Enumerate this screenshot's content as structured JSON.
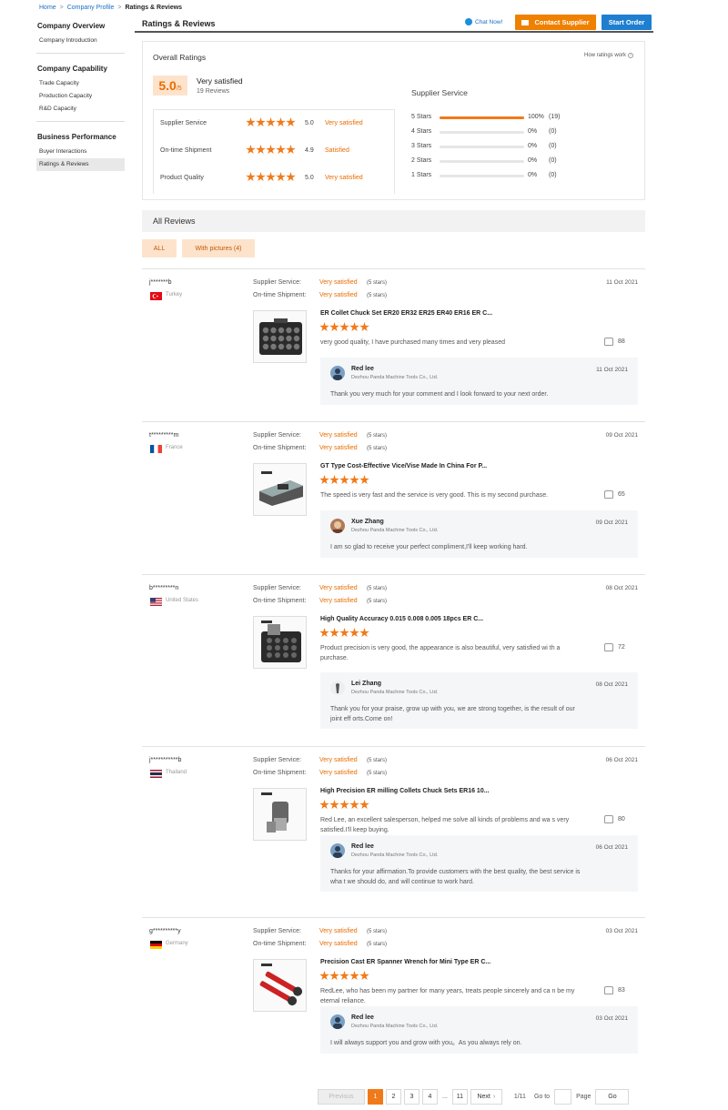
{
  "breadcrumb": {
    "home": "Home",
    "profile": "Company Profile",
    "current": "Ratings & Reviews",
    "sep": ">"
  },
  "sidebar": {
    "sections": [
      {
        "title": "Company Overview",
        "items": [
          "Company Introduction"
        ]
      },
      {
        "title": "Company Capability",
        "items": [
          "Trade Capacity",
          "Production Capacity",
          "R&D Capacity"
        ]
      },
      {
        "title": "Business Performance",
        "items": [
          "Buyer Interactions",
          "Ratings & Reviews"
        ]
      }
    ]
  },
  "header": {
    "title": "Ratings & Reviews",
    "chat": "Chat Now!",
    "contact": "Contact Supplier",
    "order": "Start Order"
  },
  "overall": {
    "title": "Overall Ratings",
    "how": "How ratings work",
    "score": "5.0",
    "scale": "/5",
    "label": "Very satisfied",
    "count": "19 Reviews",
    "rows": [
      {
        "label": "Supplier Service",
        "score": "5.0",
        "text": "Very satisfied",
        "stars": 5
      },
      {
        "label": "On-time Shipment",
        "score": "4.9",
        "text": "Satisfied",
        "stars": 5
      },
      {
        "label": "Product Quality",
        "score": "5.0",
        "text": "Very satisfied",
        "stars": 5
      }
    ],
    "dist_title": "Supplier Service",
    "dist": [
      {
        "label": "5 Stars",
        "pct": "100%",
        "count": "(19)",
        "fraction": 1.0
      },
      {
        "label": "4 Stars",
        "pct": "0%",
        "count": "(0)",
        "fraction": 0
      },
      {
        "label": "3 Stars",
        "pct": "0%",
        "count": "(0)",
        "fraction": 0
      },
      {
        "label": "2 Stars",
        "pct": "0%",
        "count": "(0)",
        "fraction": 0
      },
      {
        "label": "1 Stars",
        "pct": "0%",
        "count": "(0)",
        "fraction": 0
      }
    ]
  },
  "all_reviews": {
    "title": "All Reviews",
    "filter_all": "ALL",
    "filter_pics": "With pictures (4)"
  },
  "labels": {
    "ss": "Supplier Service:",
    "os": "On-time Shipment:",
    "stars5": "(5 stars)"
  },
  "reviews": [
    {
      "user": "j*******b",
      "country": "Turkey",
      "flag": "turkey",
      "ss": "Very satisfied",
      "os": "Very satisfied",
      "date": "11 Oct 2021",
      "product": "ER Collet Chuck Set ER20 ER32 ER25 ER40 ER16 ER C...",
      "comment": "very good quality, I have purchased many times and very pleased",
      "likes": "88",
      "reply": {
        "name": "Red lee",
        "company": "Dezhou Panda Machine Tools Co., Ltd.",
        "date": "11 Oct 2021",
        "msg": "Thank you very much for your comment and I look forward to your next order."
      }
    },
    {
      "user": "t*********m",
      "country": "France",
      "flag": "france",
      "ss": "Very satisfied",
      "os": "Very satisfied",
      "date": "09 Oct 2021",
      "product": "GT Type Cost-Effective Vice/Vise Made In China For P...",
      "comment": "The speed is very fast and the service is very good. This is my second purchase.",
      "likes": "65",
      "reply": {
        "name": "Xue Zhang",
        "company": "Dezhou Panda Machine Tools Co., Ltd.",
        "date": "09 Oct 2021",
        "msg": "I am so glad to receive your perfect compliment,I'll keep working hard."
      }
    },
    {
      "user": "b*********n",
      "country": "United States",
      "flag": "usa",
      "ss": "Very satisfied",
      "os": "Very satisfied",
      "date": "08 Oct 2021",
      "product": "High Quality Accuracy 0.015 0.008 0.005 18pcs ER C...",
      "comment": "Product precision is very good, the appearance is also beautiful, very satisfied wi th a purchase.",
      "likes": "72",
      "reply": {
        "name": "Lei Zhang",
        "company": "Dezhou Panda Machine Tools Co., Ltd.",
        "date": "08 Oct 2021",
        "msg": "Thank you for your praise, grow up with you, we are strong together, is the result of our joint eff orts.Come on!"
      }
    },
    {
      "user": "j***********b",
      "country": "Thailand",
      "flag": "thailand",
      "ss": "Very satisfied",
      "os": "Very satisfied",
      "date": "06 Oct 2021",
      "product": "High Precision ER milling Collets Chuck Sets ER16 10...",
      "comment": "Red Lee, an excellent salesperson, helped me solve all kinds of problems and wa s very satisfied.I'll keep buying.",
      "likes": "80",
      "reply": {
        "name": "Red lee",
        "company": "Dezhou Panda Machine Tools Co., Ltd.",
        "date": "06 Oct 2021",
        "msg": "Thanks for your affirmation.To provide customers with the best quality, the best service is wha t we should do, and will continue to work hard."
      }
    },
    {
      "user": "g**********y",
      "country": "Germany",
      "flag": "germany",
      "ss": "Very satisfied",
      "os": "Very satisfied",
      "date": "03 Oct 2021",
      "product": "Precision Cast ER Spanner Wrench for Mini Type ER C...",
      "comment": "RedLee, who has been my partner for many years, treats people sincerely and ca n be my eternal reliance.",
      "likes": "83",
      "reply": {
        "name": "Red lee",
        "company": "Dezhou Panda Machine Tools Co., Ltd.",
        "date": "03 Oct 2021",
        "msg": "I will always support you and grow with you。As you always rely on."
      }
    }
  ],
  "pagination": {
    "prev": "Previous",
    "pages": [
      "1",
      "2",
      "3",
      "4",
      "...",
      "11"
    ],
    "next": "Next",
    "total": "1/11",
    "goto": "Go to",
    "page": "Page",
    "go": "Go"
  },
  "colors": {
    "accent": "#f07a1a",
    "satisfied": "#e86c00",
    "link": "#1a6fc4",
    "order": "#1e7fd0"
  }
}
